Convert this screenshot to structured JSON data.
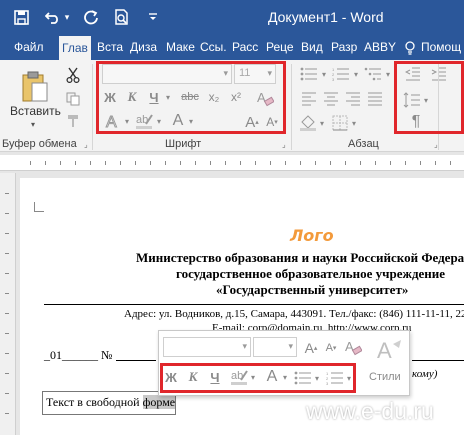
{
  "window": {
    "title": "Документ1 - Word",
    "quick_access": [
      "save-icon",
      "undo-icon",
      "undo-dropdown-icon",
      "redo-icon",
      "print-preview-icon",
      "customize-qa-icon"
    ]
  },
  "tabs": [
    {
      "label": "Файл"
    },
    {
      "label": "Глав"
    },
    {
      "label": "Вста"
    },
    {
      "label": "Диза"
    },
    {
      "label": "Маке"
    },
    {
      "label": "Ссы."
    },
    {
      "label": "Расс"
    },
    {
      "label": "Реце"
    },
    {
      "label": "Вид"
    },
    {
      "label": "Разр"
    },
    {
      "label": "ABBY"
    },
    {
      "label": "Помощ"
    }
  ],
  "tell_me_icon": "lightbulb-icon",
  "ribbon": {
    "paste_label": "Вставить",
    "groups": {
      "clipboard": "Буфер обмена",
      "font": "Шрифт",
      "paragraph": "Абзац"
    },
    "font_name": "",
    "font_size": "11",
    "font_buttons": {
      "bold": "Ж",
      "italic": "К",
      "underline": "Ч",
      "strike": "abc",
      "sub": "x₂",
      "super": "x²",
      "font_color": "A",
      "grow": "A",
      "shrink": "A",
      "case": "Aa"
    },
    "pilcrow": "¶"
  },
  "document": {
    "logo": "Лого",
    "org_line1": "Министерство образования и науки Российской Федерации",
    "org_line2": "государственное образовательное учреждение",
    "org_line3": "«Государственный университет»",
    "address": "Адрес: ул. Водников, д.15, Самара, 443091. Тел./факс: (846) 111-11-11, 222",
    "email": "E-mail: corp@domain.ru, http://www.corp.ru",
    "date_field": "_01______ №",
    "whom_fragment": "кому)",
    "textbox_text": "Текст в свободной ",
    "textbox_selected": "форме"
  },
  "mini_toolbar": {
    "font_name": "",
    "font_size": "",
    "bold": "Ж",
    "italic": "К",
    "underline": "Ч",
    "styles_label": "Стили"
  },
  "watermark": "www.e-du.ru",
  "colors": {
    "word_blue": "#2b579a",
    "highlight_red": "#e0262b",
    "logo_orange": "#f39a3b"
  }
}
